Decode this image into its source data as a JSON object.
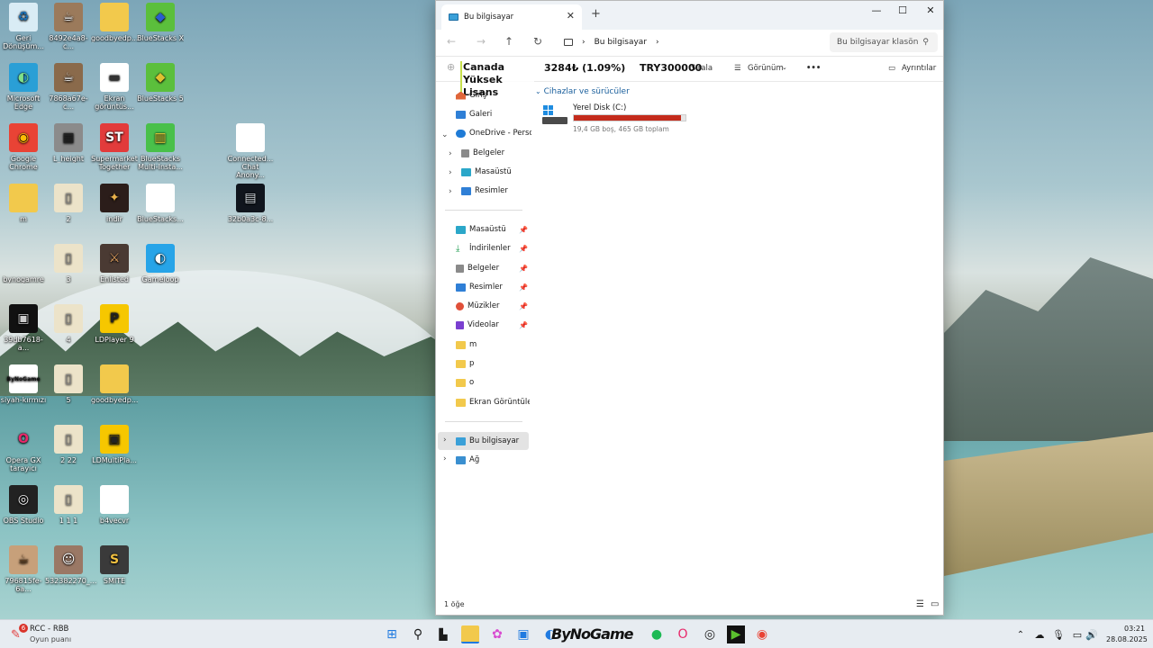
{
  "desktop": {
    "icons": [
      {
        "label": "Geri Dönüşüm...",
        "glyph": "♻",
        "color": "#d9ecf5",
        "fg": "#1a6fb5"
      },
      {
        "label": "Microsoft Edge",
        "glyph": "◐",
        "color": "#2a9fd6",
        "fg": "#7fe08a"
      },
      {
        "label": "Google Chrome",
        "glyph": "◉",
        "color": "#e94335",
        "fg": "#fbbc05"
      },
      {
        "label": "m",
        "glyph": "",
        "color": "#f2c94c",
        "fg": "#fff"
      },
      {
        "label": "bynogamre",
        "glyph": "",
        "color": "transparent",
        "fg": "#fff"
      },
      {
        "label": "39db7618-a...",
        "glyph": "▣",
        "color": "#111",
        "fg": "#ccc"
      },
      {
        "label": "siyah-kırmızı",
        "glyph": "ByNoGame",
        "color": "#fff",
        "fg": "#111"
      },
      {
        "label": "Opera GX tarayıcı",
        "glyph": "O",
        "color": "transparent",
        "fg": "#e8286a"
      },
      {
        "label": "OBS Studio",
        "glyph": "◎",
        "color": "#222",
        "fg": "#fff"
      },
      {
        "label": "796815fe-6a...",
        "glyph": "☕",
        "color": "#c7a07a",
        "fg": "#5a3a1a"
      },
      {
        "label": "8492e4a8-c...",
        "glyph": "☕",
        "color": "#9b7a5b",
        "fg": "#eee"
      },
      {
        "label": "7868a67e-c...",
        "glyph": "☕",
        "color": "#8a6a4b",
        "fg": "#eee"
      },
      {
        "label": "L_height",
        "glyph": "▦",
        "color": "#8b8b8b",
        "fg": "#222"
      },
      {
        "label": "2",
        "glyph": "▯",
        "color": "#ece3c9",
        "fg": "#888"
      },
      {
        "label": "3",
        "glyph": "▯",
        "color": "#ece3c9",
        "fg": "#888"
      },
      {
        "label": "4",
        "glyph": "▯",
        "color": "#ece3c9",
        "fg": "#888"
      },
      {
        "label": "5",
        "glyph": "▯",
        "color": "#ece3c9",
        "fg": "#888"
      },
      {
        "label": "2 22",
        "glyph": "▯",
        "color": "#ece3c9",
        "fg": "#888"
      },
      {
        "label": "1 1 1",
        "glyph": "▯",
        "color": "#ece3c9",
        "fg": "#888"
      },
      {
        "label": "532382270_...",
        "glyph": "☺",
        "color": "#9a7865",
        "fg": "#fff"
      },
      {
        "label": "goodbyedp...",
        "glyph": "",
        "color": "#f2c94c",
        "fg": "#fff"
      },
      {
        "label": "Ekran görüntüs...",
        "glyph": "▬",
        "color": "#fff",
        "fg": "#333"
      },
      {
        "label": "Supermarket Together",
        "glyph": "ST",
        "color": "#e23b3b",
        "fg": "#fff"
      },
      {
        "label": "indir",
        "glyph": "✦",
        "color": "#2b1d1a",
        "fg": "#e8b04b"
      },
      {
        "label": "Enlisted",
        "glyph": "⚔",
        "color": "#4a3a33",
        "fg": "#e0a060"
      },
      {
        "label": "LDPlayer 9",
        "glyph": "P",
        "color": "#f6c700",
        "fg": "#222"
      },
      {
        "label": "goodbyedp...",
        "glyph": "",
        "color": "#f2c94c",
        "fg": "#fff"
      },
      {
        "label": "LDMultiPla...",
        "glyph": "▣",
        "color": "#f6c700",
        "fg": "#222"
      },
      {
        "label": "b4vecvr",
        "glyph": "",
        "color": "#fff",
        "fg": "#fff"
      },
      {
        "label": "SMITE",
        "glyph": "S",
        "color": "#3a3a3a",
        "fg": "#f1c040"
      },
      {
        "label": "BlueStacks X",
        "glyph": "◆",
        "color": "#5bbf3c",
        "fg": "#2a5ccf"
      },
      {
        "label": "BlueStacks 5",
        "glyph": "◆",
        "color": "#5bbf3c",
        "fg": "#e0c030"
      },
      {
        "label": "BlueStacks Multi-Insta...",
        "glyph": "▥",
        "color": "#49c04a",
        "fg": "#f3d23a"
      },
      {
        "label": "BlueStacks...",
        "glyph": "",
        "color": "#fff",
        "fg": "#aaa"
      },
      {
        "label": "Gameloop",
        "glyph": "◐",
        "color": "#27a4e8",
        "fg": "#fff"
      },
      {
        "label": "Connected... Chat Anony...",
        "glyph": "",
        "color": "#fff",
        "fg": "#aaa"
      },
      {
        "label": "32b0a3c-8...",
        "glyph": "▤",
        "color": "#10151d",
        "fg": "#cfd6dd"
      }
    ]
  },
  "explorer": {
    "tab_title": "Bu bilgisayar",
    "close_tab": "✕",
    "new_tab": "+",
    "window_controls": {
      "minimize": "—",
      "maximize": "☐",
      "close": "✕"
    },
    "breadcrumb": [
      "Bu bilgisayar"
    ],
    "search_placeholder": "Bu bilgisayar klasön",
    "overlay": {
      "title": "Canada Yüksek Lisans",
      "value1": "3284₺ (1.09%)",
      "value2": "TRY300000"
    },
    "commands": {
      "sort": "Sırala",
      "view": "Görünüm",
      "more": "•••",
      "details": "Ayrıntılar"
    },
    "nav": {
      "home": "Giriş",
      "gallery": "Galeri",
      "onedrive": "OneDrive - Persona",
      "od_children": [
        "Belgeler",
        "Masaüstü",
        "Resimler"
      ],
      "quick": [
        "Masaüstü",
        "İndirilenler",
        "Belgeler",
        "Resimler",
        "Müzikler",
        "Videolar"
      ],
      "folders": [
        "m",
        "p",
        "o",
        "Ekran Görüntüleri"
      ],
      "this_pc": "Bu bilgisayar",
      "network": "Ağ"
    },
    "section_header": "Cihazlar ve sürücüler",
    "drive": {
      "name": "Yerel Disk (C:)",
      "info": "19,4 GB boş, 465 GB toplam",
      "used_fraction": 0.958,
      "bar_color": "#c42b1c"
    },
    "status": "1 öğe"
  },
  "taskbar": {
    "notification_badge": "6",
    "game_title": "RCC - RBB",
    "game_sub": "Oyun puanı",
    "watermark": "ByNoGame",
    "time": "03:21",
    "date": "28.08.2025"
  }
}
